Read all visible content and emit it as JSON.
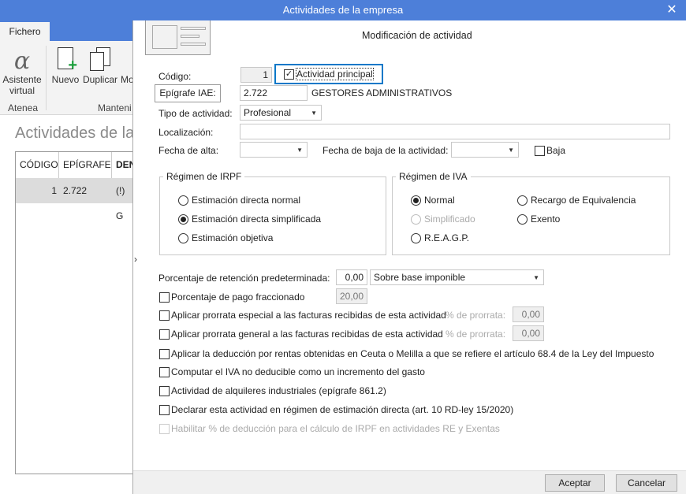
{
  "window": {
    "title": "Actividades de la empresa",
    "close_icon": "close-icon"
  },
  "ribbon": {
    "tab": "Fichero",
    "buttons": [
      {
        "label1": "Asistente",
        "label2": "virtual"
      },
      {
        "label1": "Nuevo"
      },
      {
        "label1": "Duplicar"
      },
      {
        "label1": "Mo"
      }
    ],
    "groups": [
      "Atenea",
      "Manteni"
    ]
  },
  "app": {
    "title": "Actividades de la",
    "columns": [
      "CÓDIGO",
      "EPÍGRAFE",
      "DEN"
    ],
    "rows": [
      {
        "codigo": "1",
        "epigrafe": "2.722",
        "den": "(!) G"
      }
    ]
  },
  "dialog": {
    "title": "Modificación de actividad",
    "codigo_label": "Código:",
    "codigo_value": "1",
    "actividad_principal": "Actividad principal",
    "actividad_principal_checked": true,
    "epigrafe_button": "Epígrafe IAE:",
    "epigrafe_value": "2.722",
    "epigrafe_desc": "GESTORES ADMINISTRATIVOS",
    "tipo_label": "Tipo de actividad:",
    "tipo_value": "Profesional",
    "localizacion_label": "Localización:",
    "localizacion_value": "",
    "fecha_alta_label": "Fecha de alta:",
    "fecha_alta_value": "",
    "fecha_baja_label": "Fecha de baja de la actividad:",
    "fecha_baja_value": "",
    "baja_label": "Baja",
    "baja_checked": false,
    "irpf": {
      "title": "Régimen de IRPF",
      "options": [
        "Estimación directa normal",
        "Estimación directa simplificada",
        "Estimación objetiva"
      ],
      "selected": "Estimación directa simplificada"
    },
    "iva": {
      "title": "Régimen de IVA",
      "options": [
        "Normal",
        "Simplificado",
        "R.E.A.G.P.",
        "Recargo de Equivalencia",
        "Exento"
      ],
      "selected": "Normal",
      "disabled": [
        "Simplificado"
      ]
    },
    "retencion_label": "Porcentaje de retención predeterminada:",
    "retencion_value": "0,00",
    "retencion_base": "Sobre base imponible",
    "pago_fraccionado_label": "Porcentaje de pago fraccionado",
    "pago_fraccionado_value": "20,00",
    "prorrata_especial_label": "Aplicar prorrata especial a las facturas recibidas de esta actividad",
    "prorrata_general_label": "Aplicar prorrata general a las facturas recibidas de esta actividad",
    "prorrata_pct_label": "% de prorrata:",
    "prorrata_especial_value": "0,00",
    "prorrata_general_value": "0,00",
    "ceuta_label": "Aplicar la deducción por rentas obtenidas en Ceuta o Melilla a que se refiere el artículo 68.4 de la Ley del Impuesto",
    "iva_no_deducible_label": "Computar el IVA no deducible como un incremento del gasto",
    "alquileres_label": "Actividad de alquileres industriales (epígrafe 861.2)",
    "estimacion_directa_label": "Declarar esta actividad en régimen de estimación directa (art. 10 RD-ley 15/2020)",
    "habilitar_label": "Habilitar % de deducción para el cálculo de IRPF en actividades RE y Exentas",
    "accept": "Aceptar",
    "cancel": "Cancelar"
  },
  "colors": {
    "titlebar": "#4d7fd9",
    "focus": "#0a78c8"
  }
}
